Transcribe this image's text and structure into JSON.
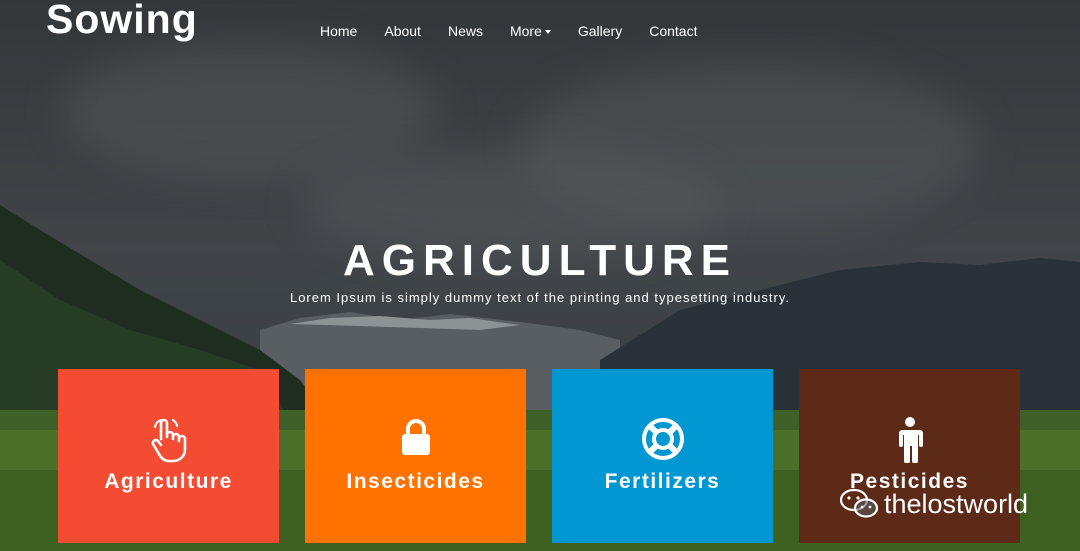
{
  "brand": "Sowing",
  "nav": {
    "items": [
      {
        "label": "Home"
      },
      {
        "label": "About"
      },
      {
        "label": "News"
      },
      {
        "label": "More"
      },
      {
        "label": "Gallery"
      },
      {
        "label": "Contact"
      }
    ]
  },
  "hero": {
    "title": "AGRICULTURE",
    "subtitle": "Lorem Ipsum is simply dummy text of the printing and typesetting industry."
  },
  "cards": [
    {
      "label": "Agriculture",
      "icon": "hand-pointer-icon",
      "color": "#f44b33"
    },
    {
      "label": "Insecticides",
      "icon": "lock-icon",
      "color": "#ff7200"
    },
    {
      "label": "Fertilizers",
      "icon": "life-ring-icon",
      "color": "#0097d3"
    },
    {
      "label": "Pesticides",
      "icon": "person-icon",
      "color": "#5c2a17"
    }
  ],
  "watermark": {
    "text": "thelostworld",
    "icon": "wechat-icon"
  }
}
